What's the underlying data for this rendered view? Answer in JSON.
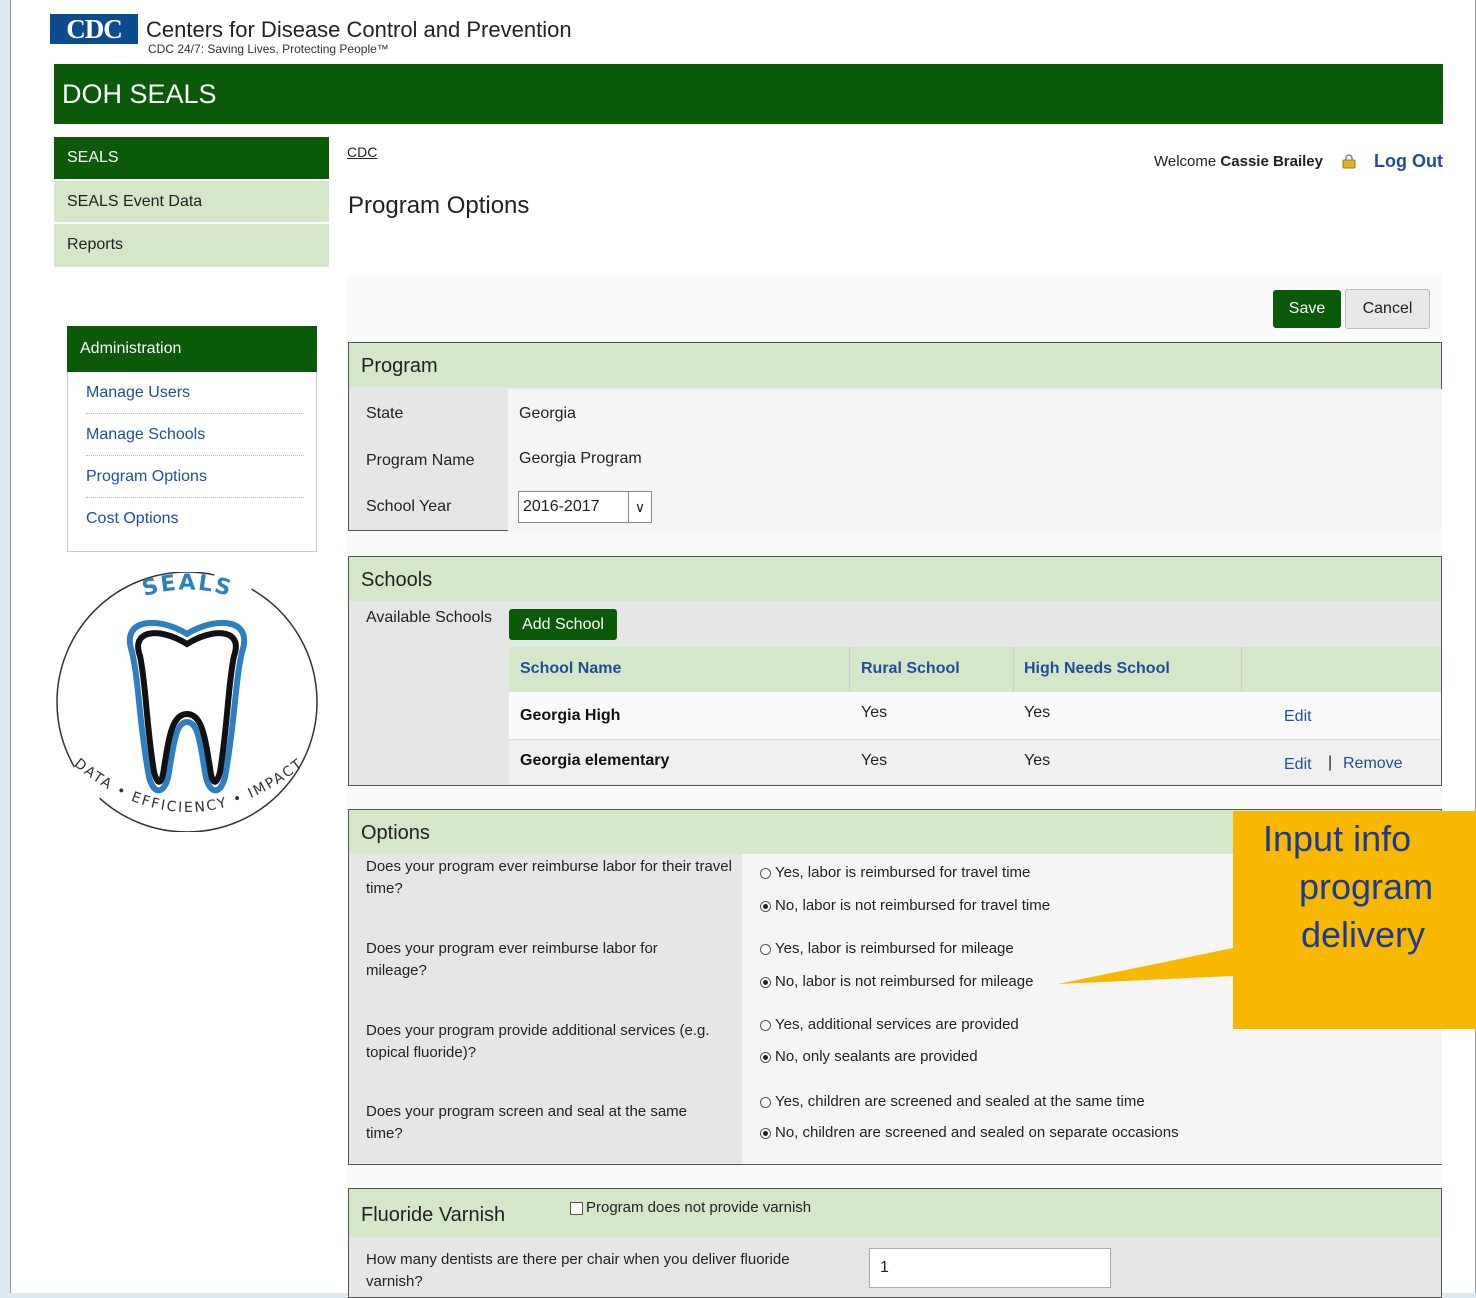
{
  "header": {
    "logo_text": "CDC",
    "org_name": "Centers for Disease Control and Prevention",
    "tagline": "CDC 24/7: Saving Lives, Protecting People™",
    "app_title": "DOH SEALS"
  },
  "sidebar": {
    "nav": [
      "SEALS",
      "SEALS Event Data",
      "Reports"
    ],
    "admin_title": "Administration",
    "admin_links": [
      "Manage Users",
      "Manage Schools",
      "Program Options",
      "Cost Options"
    ],
    "seals_logo_top": "SEALS",
    "seals_logo_bottom": "DATA • EFFICIENCY • IMPACT"
  },
  "breadcrumb": "CDC",
  "user": {
    "welcome": "Welcome",
    "name": "Cassie Brailey",
    "logout": "Log Out"
  },
  "page_title": "Program Options",
  "buttons": {
    "save": "Save",
    "cancel": "Cancel",
    "add_school": "Add School"
  },
  "program": {
    "title": "Program",
    "state_label": "State",
    "state_value": "Georgia",
    "name_label": "Program Name",
    "name_value": "Georgia Program",
    "year_label": "School Year",
    "year_value": "2016-2017"
  },
  "schools": {
    "title": "Schools",
    "available_label": "Available Schools",
    "columns": [
      "School Name",
      "Rural School",
      "High Needs School"
    ],
    "rows": [
      {
        "name": "Georgia High",
        "rural": "Yes",
        "high_needs": "Yes",
        "edit": "Edit",
        "remove": ""
      },
      {
        "name": "Georgia elementary",
        "rural": "Yes",
        "high_needs": "Yes",
        "edit": "Edit",
        "remove": "Remove"
      }
    ],
    "separator": "|"
  },
  "options": {
    "title": "Options",
    "questions": [
      {
        "q": "Does your program ever reimburse labor for their travel time?",
        "yes": "Yes, labor is reimbursed for travel time",
        "no": "No, labor is not reimbursed for travel time",
        "selected": "no"
      },
      {
        "q": "Does your program ever reimburse labor for mileage?",
        "yes": "Yes, labor is reimbursed for mileage",
        "no": "No, labor is not reimbursed for mileage",
        "selected": "no"
      },
      {
        "q": "Does your program provide additional services (e.g. topical fluoride)?",
        "yes": "Yes, additional services are provided",
        "no": "No, only sealants are provided",
        "selected": "no"
      },
      {
        "q": "Does your program screen and seal at the same time?",
        "yes": "Yes, children are screened and sealed at the same time",
        "no": "No, children are screened and sealed on separate occasions",
        "selected": "no"
      }
    ]
  },
  "fluoride": {
    "title": "Fluoride Varnish",
    "checkbox_label": "Program does not provide varnish",
    "question": "How many dentists are there per chair when you deliver fluoride varnish?",
    "value": "1"
  },
  "callout": {
    "lines": [
      "Input info",
      "program",
      "delivery"
    ]
  },
  "colors": {
    "green": "#0a5a0a",
    "light_green": "#d6e6c9",
    "link": "#1f4e9a",
    "callout": "#f9b800"
  }
}
